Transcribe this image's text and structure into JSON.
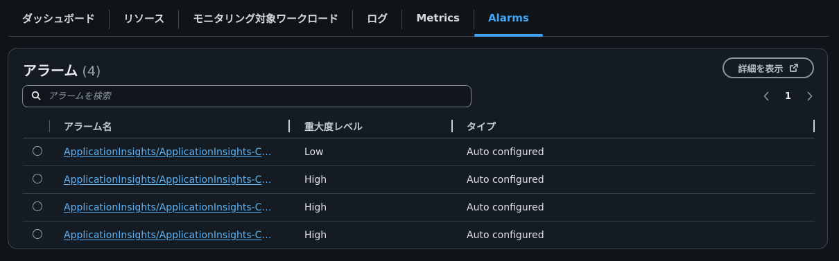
{
  "tabs": [
    {
      "label": "ダッシュボード",
      "active": false
    },
    {
      "label": "リソース",
      "active": false
    },
    {
      "label": "モニタリング対象ワークロード",
      "active": false
    },
    {
      "label": "ログ",
      "active": false
    },
    {
      "label": "Metrics",
      "active": false
    },
    {
      "label": "Alarms",
      "active": true
    }
  ],
  "panel": {
    "title": "アラーム",
    "count": "(4)",
    "details_button": "詳細を表示",
    "search_placeholder": "アラームを検索",
    "page": "1"
  },
  "table": {
    "headers": {
      "name": "アラーム名",
      "severity": "重大度レベル",
      "type": "タイプ"
    },
    "rows": [
      {
        "name": "ApplicationInsights/ApplicationInsights-Containe",
        "severity": "Low",
        "type": "Auto configured"
      },
      {
        "name": "ApplicationInsights/ApplicationInsights-Containe",
        "severity": "High",
        "type": "Auto configured"
      },
      {
        "name": "ApplicationInsights/ApplicationInsights-Containe",
        "severity": "High",
        "type": "Auto configured"
      },
      {
        "name": "ApplicationInsights/ApplicationInsights-Containe",
        "severity": "High",
        "type": "Auto configured"
      }
    ]
  },
  "colors": {
    "accent": "#42a5f5",
    "link": "#5db3f5",
    "background": "#0f1419",
    "panel": "#151b22"
  },
  "icons": {
    "search": "search-icon",
    "external": "external-link-icon",
    "prev": "chevron-left-icon",
    "next": "chevron-right-icon"
  }
}
